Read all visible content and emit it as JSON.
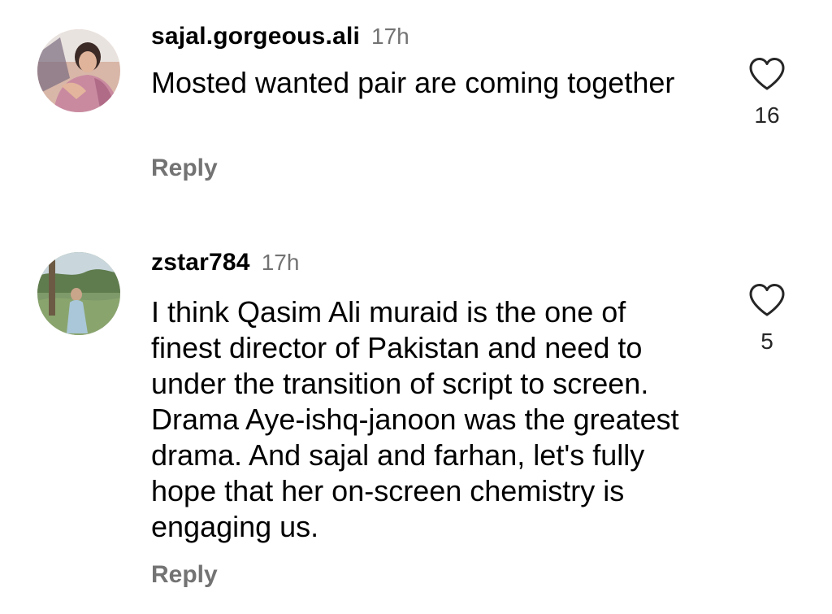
{
  "comments": [
    {
      "username": "sajal.gorgeous.ali",
      "time": "17h",
      "text": "Mosted wanted pair are coming together",
      "reply_label": "Reply",
      "like_count": "16",
      "like_icon": "heart-outline-icon"
    },
    {
      "username": "zstar784",
      "time": "17h",
      "text": "I think Qasim Ali muraid is the one of finest director of Pakistan and need to under the transition of script to screen. Drama Aye-ishq-janoon was the greatest drama. And sajal and farhan, let's fully hope that her on-screen chemistry is engaging us.",
      "reply_label": "Reply",
      "like_count": "5",
      "like_icon": "heart-outline-icon"
    }
  ],
  "colors": {
    "text": "#000000",
    "secondary": "#737373",
    "count": "#262626",
    "icon": "#262626"
  }
}
